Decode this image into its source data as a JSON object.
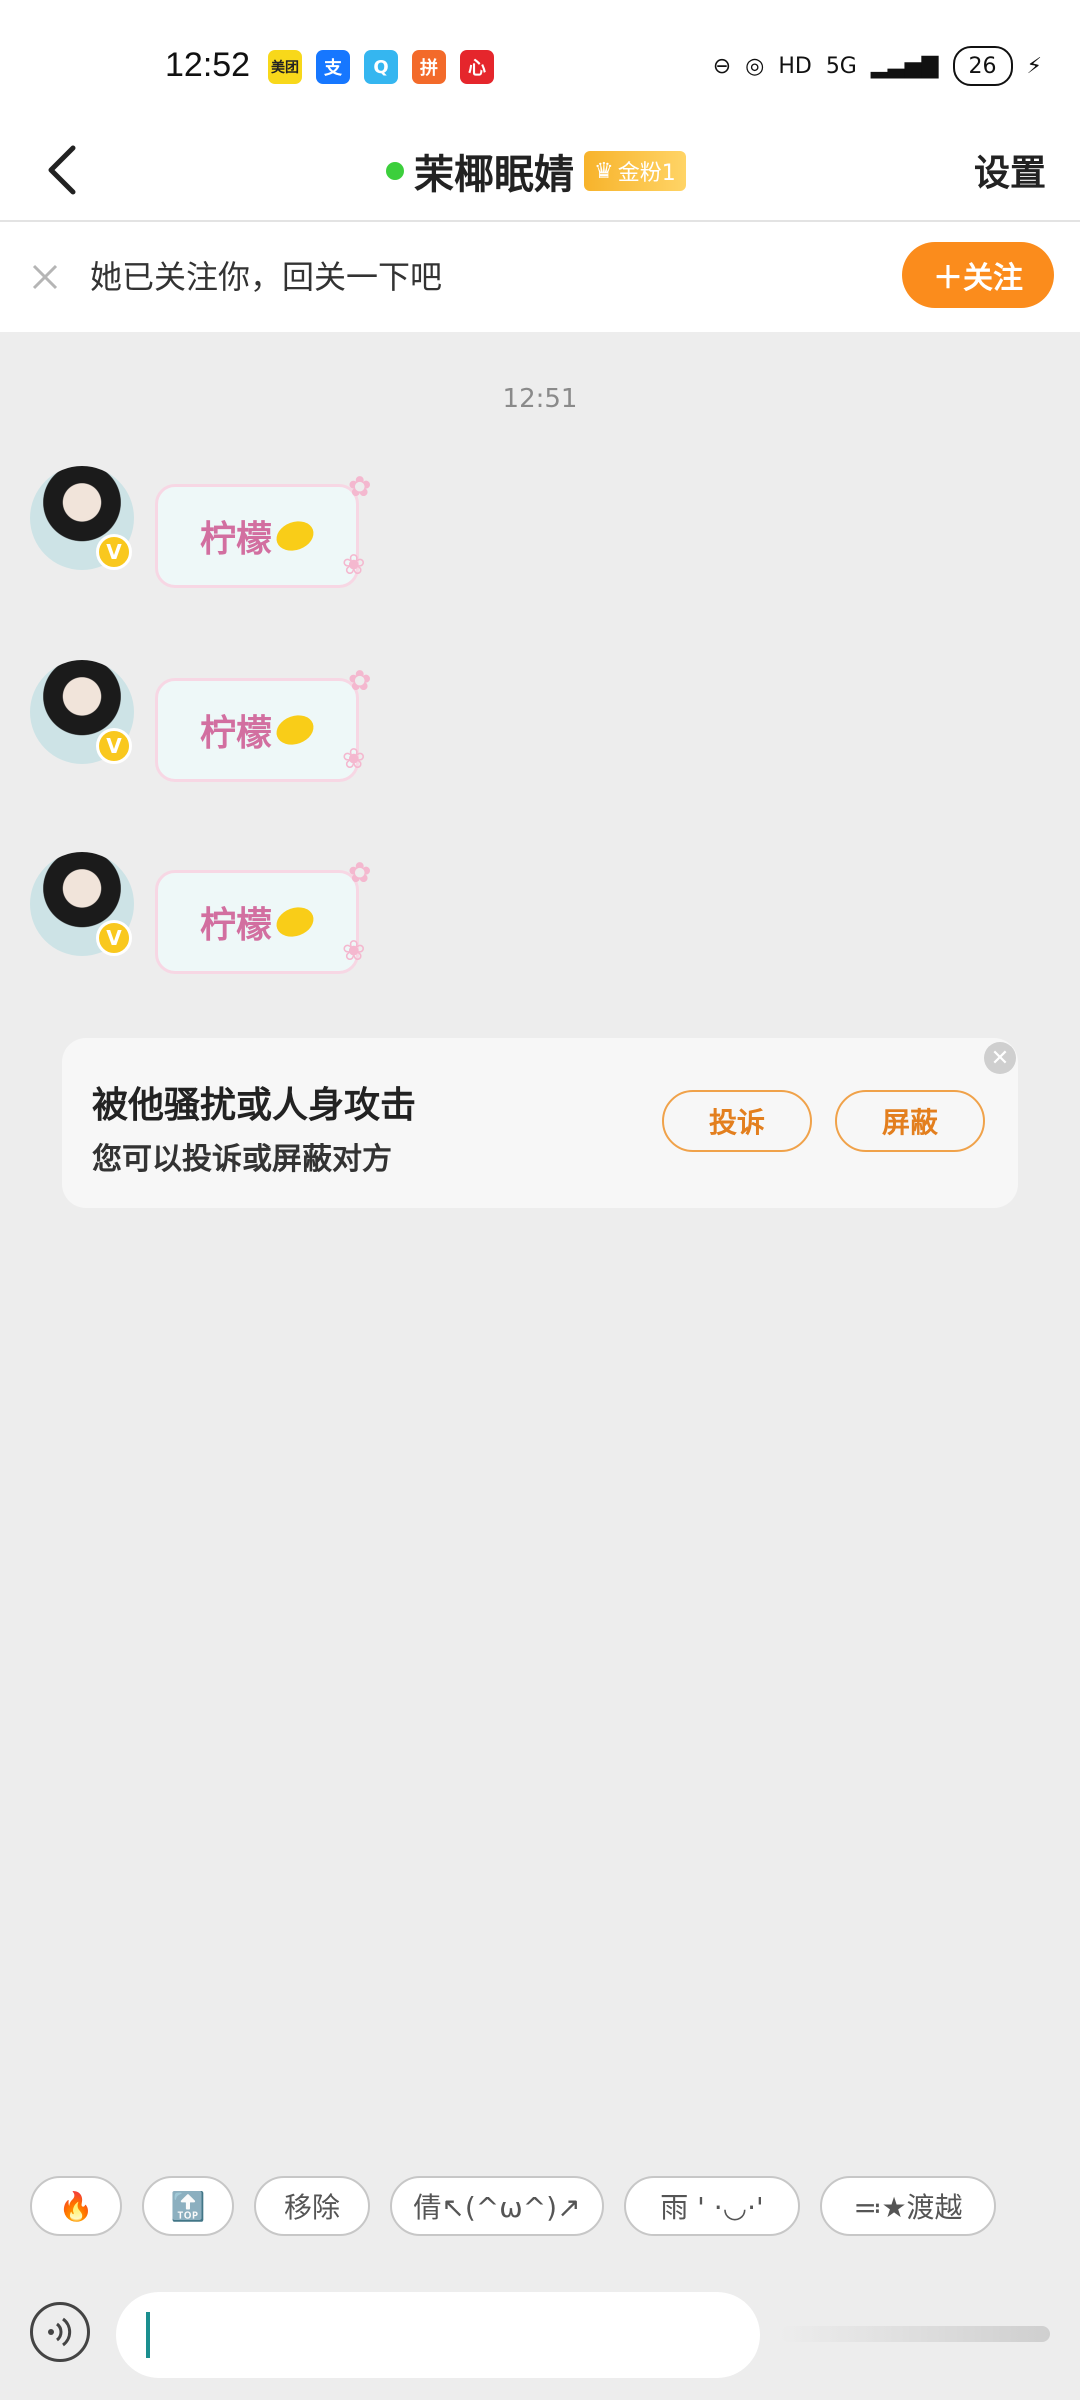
{
  "status_bar": {
    "time": "12:52",
    "apps": [
      {
        "icon": "meituan-icon",
        "label": "美团",
        "color": "#f8d81a"
      },
      {
        "icon": "alipay-icon",
        "label": "支",
        "color": "#1677ff"
      },
      {
        "icon": "browser-icon",
        "label": "Q",
        "color": "#35b6f0"
      },
      {
        "icon": "shop-icon",
        "label": "拼",
        "color": "#f36a2a"
      },
      {
        "icon": "heart-app-icon",
        "label": "心",
        "color": "#e5262c"
      }
    ],
    "network": "5G",
    "battery": "26"
  },
  "nav": {
    "title": "茉椰眠婧",
    "badge": "金粉1",
    "settings": "设置",
    "online_color": "#3ccf3c"
  },
  "follow_bar": {
    "text": "她已关注你，回关一下吧",
    "button": "＋关注"
  },
  "chat": {
    "timestamp": "12:51",
    "messages": [
      {
        "text": "柠檬"
      },
      {
        "text": "柠檬"
      },
      {
        "text": "柠檬"
      }
    ]
  },
  "report_card": {
    "title": "被他骚扰或人身攻击",
    "subtitle": "您可以投诉或屏蔽对方",
    "complain": "投诉",
    "block": "屏蔽"
  },
  "chips": [
    {
      "icon": "fire-icon",
      "label": "🔥"
    },
    {
      "icon": "top-icon",
      "label": "🔝"
    },
    {
      "label": "移除"
    },
    {
      "label": "倩↖(^ω^)↗"
    },
    {
      "label": "雨 ' ·◡·'"
    },
    {
      "label": "≕★渡越"
    }
  ],
  "accent": "#fb8c1c"
}
